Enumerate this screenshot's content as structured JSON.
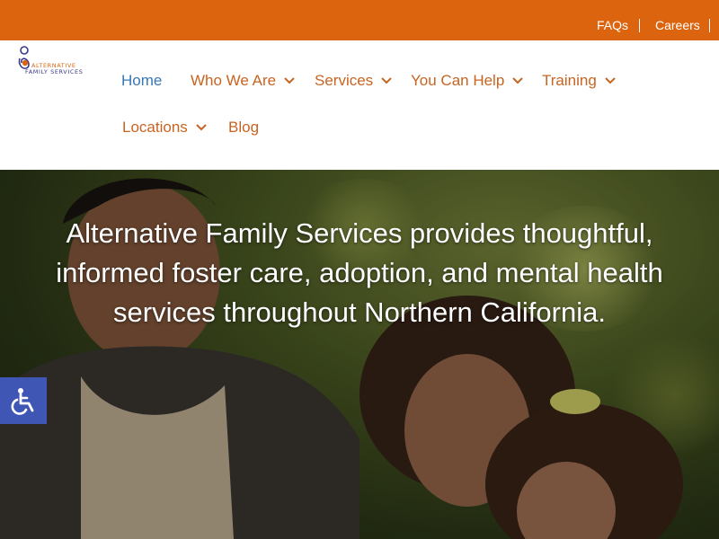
{
  "topbar": {
    "links": [
      {
        "label": "FAQs"
      },
      {
        "label": "Careers"
      }
    ]
  },
  "logo": {
    "line1": "ALTERNATIVE",
    "line2": "FAMILY SERVICES"
  },
  "nav": {
    "items": [
      {
        "label": "Home",
        "active": true
      },
      {
        "label": "Who We Are",
        "has_dropdown": true
      },
      {
        "label": "Services",
        "has_dropdown": true
      },
      {
        "label": "You Can Help",
        "has_dropdown": true
      },
      {
        "label": "Training",
        "has_dropdown": true
      },
      {
        "label": "Locations",
        "has_dropdown": true
      },
      {
        "label": "Blog"
      }
    ]
  },
  "hero": {
    "headline": "Alternative Family Services provides thoughtful, informed foster care, adoption, and mental health services throughout Northern California."
  },
  "accessibility": {
    "icon": "wheelchair-icon"
  },
  "colors": {
    "topbar": "#dd640e",
    "nav_text": "#c86421",
    "nav_active": "#3777b6",
    "accessibility_button": "#3f56b5"
  }
}
